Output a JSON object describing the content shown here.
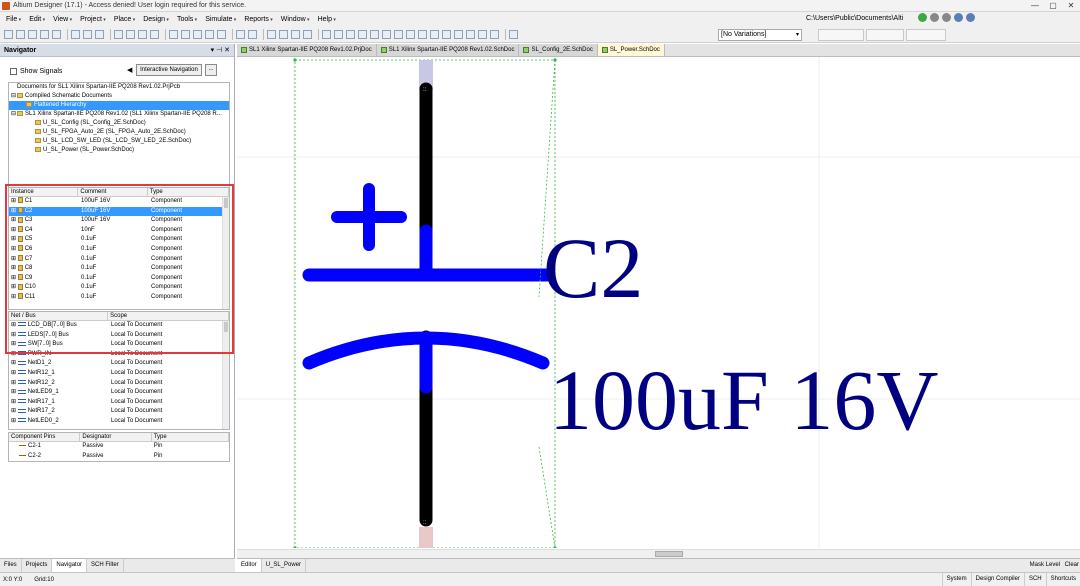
{
  "window": {
    "title": "Altium Designer (17.1) - Access denied! User login required for this service.",
    "controls": [
      "—",
      "▢",
      "✕"
    ]
  },
  "menu": [
    "File",
    "Edit",
    "View",
    "Project",
    "Place",
    "Design",
    "Tools",
    "Simulate",
    "Reports",
    "Window",
    "Help"
  ],
  "path": "C:\\Users\\Public\\Documents\\Alti",
  "variations": "[No Variations]",
  "navigator": {
    "title": "Navigator",
    "show_signals": "Show Signals",
    "interactive_nav": "Interactive Navigation",
    "dots": "...",
    "doc_tree": [
      {
        "text": "Documents for SL1 Xilinx Spartan-IIE PQ208 Rev1.02.PrjPcb",
        "indent": 0,
        "exp": "",
        "icon": false,
        "selected": false
      },
      {
        "text": "Compiled  Schematic Documents",
        "indent": 0,
        "exp": "⊟",
        "icon": true,
        "selected": false
      },
      {
        "text": "Flattened Hierarchy",
        "indent": 1,
        "exp": "",
        "icon": true,
        "selected": true
      },
      {
        "text": "SL1 Xilinx Spartan-IIE PQ208 Rev1.02 (SL1 Xilinx Spartan-IIE PQ208 R...",
        "indent": 0,
        "exp": "⊟",
        "icon": true,
        "selected": false
      },
      {
        "text": "U_SL_Config (SL_Config_2E.SchDoc)",
        "indent": 2,
        "exp": "",
        "icon": true,
        "selected": false
      },
      {
        "text": "U_SL_FPGA_Auto_2E (SL_FPGA_Auto_2E.SchDoc)",
        "indent": 2,
        "exp": "",
        "icon": true,
        "selected": false
      },
      {
        "text": "U_SL_LCD_SW_LED (SL_LCD_SW_LED_2E.SchDoc)",
        "indent": 2,
        "exp": "",
        "icon": true,
        "selected": false
      },
      {
        "text": "U_SL_Power (SL_Power.SchDoc)",
        "indent": 2,
        "exp": "",
        "icon": true,
        "selected": false
      }
    ],
    "instance_headers": [
      "Instance",
      "Comment",
      "Type"
    ],
    "instances": [
      {
        "instance": "C1",
        "comment": "100uF 16V",
        "type": "Component",
        "selected": false
      },
      {
        "instance": "C2",
        "comment": "100uF 16V",
        "type": "Component",
        "selected": true
      },
      {
        "instance": "C3",
        "comment": "100uF 16V",
        "type": "Component",
        "selected": false
      },
      {
        "instance": "C4",
        "comment": "10nF",
        "type": "Component",
        "selected": false
      },
      {
        "instance": "C5",
        "comment": "0.1uF",
        "type": "Component",
        "selected": false
      },
      {
        "instance": "C6",
        "comment": "0.1uF",
        "type": "Component",
        "selected": false
      },
      {
        "instance": "C7",
        "comment": "0.1uF",
        "type": "Component",
        "selected": false
      },
      {
        "instance": "C8",
        "comment": "0.1uF",
        "type": "Component",
        "selected": false
      },
      {
        "instance": "C9",
        "comment": "0.1uF",
        "type": "Component",
        "selected": false
      },
      {
        "instance": "C10",
        "comment": "0.1uF",
        "type": "Component",
        "selected": false
      },
      {
        "instance": "C11",
        "comment": "0.1uF",
        "type": "Component",
        "selected": false
      }
    ],
    "net_headers": [
      "Net / Bus",
      "Scope"
    ],
    "nets": [
      {
        "net": "LCD_DB[7..0] Bus",
        "scope": "Local To Document"
      },
      {
        "net": "LEDS[7..0] Bus",
        "scope": "Local To Document"
      },
      {
        "net": "SW[7..0] Bus",
        "scope": "Local To Document"
      },
      {
        "net": "PWR_IN",
        "scope": "Local To Document"
      },
      {
        "net": "NetD1_2",
        "scope": "Local To Document"
      },
      {
        "net": "NetR12_1",
        "scope": "Local To Document"
      },
      {
        "net": "NetR12_2",
        "scope": "Local To Document"
      },
      {
        "net": "NetLED9_1",
        "scope": "Local To Document"
      },
      {
        "net": "NetR17_1",
        "scope": "Local To Document"
      },
      {
        "net": "NetR17_2",
        "scope": "Local To Document"
      },
      {
        "net": "NetLED0_2",
        "scope": "Local To Document"
      }
    ],
    "pin_headers": [
      "Component Pins",
      "Designator",
      "Type"
    ],
    "pins": [
      {
        "pin": "C2-1",
        "designator": "Passive",
        "type": "Pin"
      },
      {
        "pin": "C2-2",
        "designator": "Passive",
        "type": "Pin"
      }
    ],
    "bottom_tabs": [
      "Files",
      "Projects",
      "Navigator",
      "SCH Filter"
    ]
  },
  "doc_tabs": [
    {
      "label": "SL1 Xilinx Spartan-IIE PQ208 Rev1.02.PrjDoc",
      "active": false
    },
    {
      "label": "SL1 Xilinx Spartan-IIE PQ208 Rev1.02.SchDoc",
      "active": false
    },
    {
      "label": "SL_Config_2E.SchDoc",
      "active": false
    },
    {
      "label": "SL_Power.SchDoc",
      "active": true
    }
  ],
  "schematic": {
    "designator": "C2",
    "comment": "100uF 16V",
    "plus": "+"
  },
  "editor_tabs": [
    "Editor",
    "U_SL_Power"
  ],
  "mask_level": "Mask Level",
  "clear": "Clear",
  "status": {
    "coords": "X:0 Y:0",
    "grid": "Grid:10",
    "right": [
      "System",
      "Design Compiler",
      "SCH",
      "Shortcuts"
    ]
  },
  "colors": {
    "schematic_blue": "#0000ff",
    "text_navy": "#000080",
    "selection": "#3399ff",
    "highlight_frame": "#e0393e"
  }
}
